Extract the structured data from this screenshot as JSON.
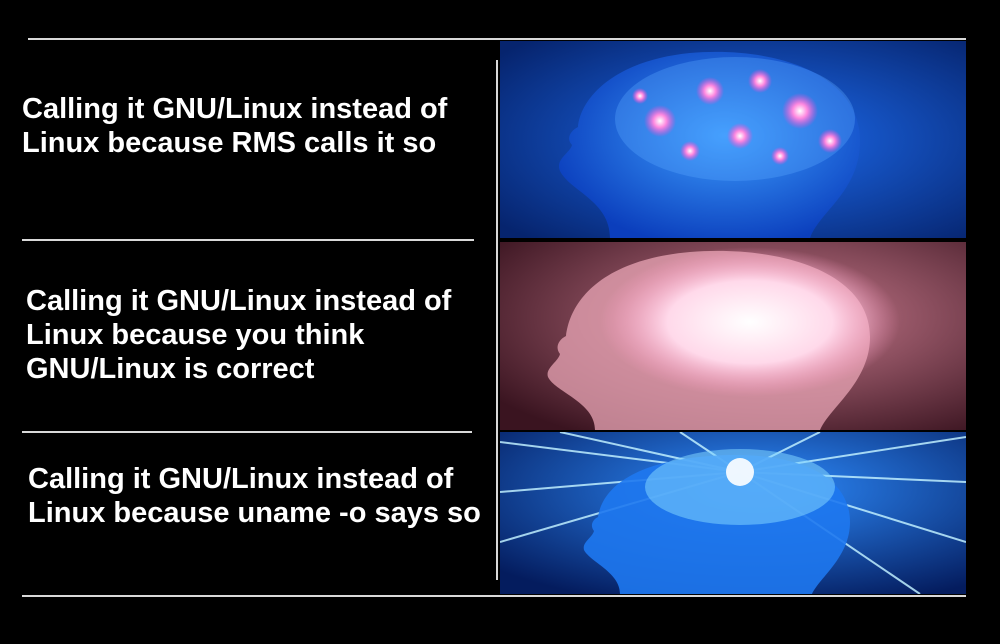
{
  "meme": {
    "panels": [
      {
        "caption": "Calling it GNU/Linux instead of Linux because RMS calls it so",
        "image": "brain-glowing-pink-neurons",
        "background": "#0a3fae",
        "glow": "#ff6fd8"
      },
      {
        "caption": "Calling it GNU/Linux instead of Linux because you think GNU/Linux is correct",
        "image": "brain-radiant-white-pink",
        "background": "#6e2c3e",
        "glow": "#ffe7f3"
      },
      {
        "caption": "Calling it GNU/Linux instead of Linux because uname -o says so",
        "image": "brain-galaxy-blue-rays",
        "background": "#072e8c",
        "glow": "#66dcff"
      }
    ]
  }
}
